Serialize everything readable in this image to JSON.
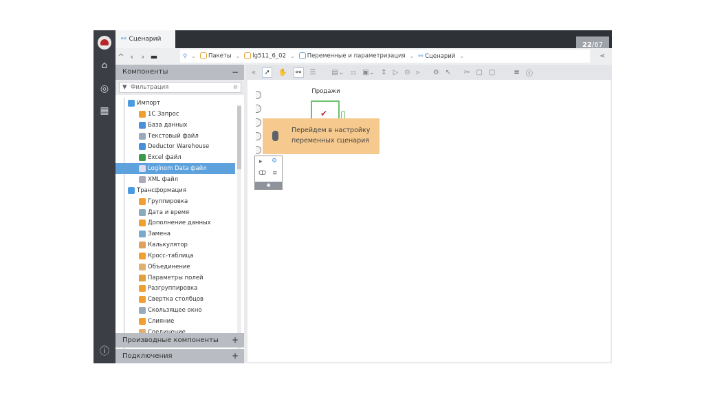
{
  "tab": {
    "label": "Сценарий"
  },
  "slide": {
    "current": "22",
    "total": "/67"
  },
  "breadcrumbs": [
    "Пакеты",
    "lg511_6_02",
    "Переменные и параметризация",
    "Сценарий"
  ],
  "components_panel": {
    "title": "Компоненты",
    "collapse": "−",
    "filter_placeholder": "Фильтрация"
  },
  "tree": [
    {
      "label": "Импорт",
      "level": 0,
      "color": "#4a9be0"
    },
    {
      "label": "1С Запрос",
      "level": 1,
      "color": "#f0a030"
    },
    {
      "label": "База данных",
      "level": 1,
      "color": "#4a8fd8"
    },
    {
      "label": "Текстовый файл",
      "level": 1,
      "color": "#9ab"
    },
    {
      "label": "Deductor Warehouse",
      "level": 1,
      "color": "#4a8fd8"
    },
    {
      "label": "Excel файл",
      "level": 1,
      "color": "#3a9a4a"
    },
    {
      "label": "Loginom Data файл",
      "level": 1,
      "color": "#dde",
      "selected": true
    },
    {
      "label": "XML файл",
      "level": 1,
      "color": "#aab"
    },
    {
      "label": "Трансформация",
      "level": 0,
      "color": "#4a9be0"
    },
    {
      "label": "Группировка",
      "level": 1,
      "color": "#f0a030"
    },
    {
      "label": "Дата и время",
      "level": 1,
      "color": "#8ab"
    },
    {
      "label": "Дополнение данных",
      "level": 1,
      "color": "#f0a030"
    },
    {
      "label": "Замена",
      "level": 1,
      "color": "#7ac"
    },
    {
      "label": "Калькулятор",
      "level": 1,
      "color": "#e0a060"
    },
    {
      "label": "Кросс-таблица",
      "level": 1,
      "color": "#f0a030"
    },
    {
      "label": "Объединение",
      "level": 1,
      "color": "#e0b070"
    },
    {
      "label": "Параметры полей",
      "level": 1,
      "color": "#e0a040"
    },
    {
      "label": "Разгруппировка",
      "level": 1,
      "color": "#f0a030"
    },
    {
      "label": "Свертка столбцов",
      "level": 1,
      "color": "#f0a030"
    },
    {
      "label": "Скользящее окно",
      "level": 1,
      "color": "#9ab"
    },
    {
      "label": "Слияние",
      "level": 1,
      "color": "#f0a030"
    },
    {
      "label": "Соединение",
      "level": 1,
      "color": "#e0b070"
    }
  ],
  "bottom_panels": [
    {
      "label": "Производные компоненты",
      "action": "+"
    },
    {
      "label": "Подключения",
      "action": "+"
    }
  ],
  "canvas": {
    "node_label": "Продажи",
    "tooltip_line1": "Перейдем в настройку",
    "tooltip_line2": "переменных сценария"
  },
  "colors": {
    "accent": "#5ea2dd",
    "tooltip": "#f6c98e",
    "dark": "#3b3e44"
  }
}
